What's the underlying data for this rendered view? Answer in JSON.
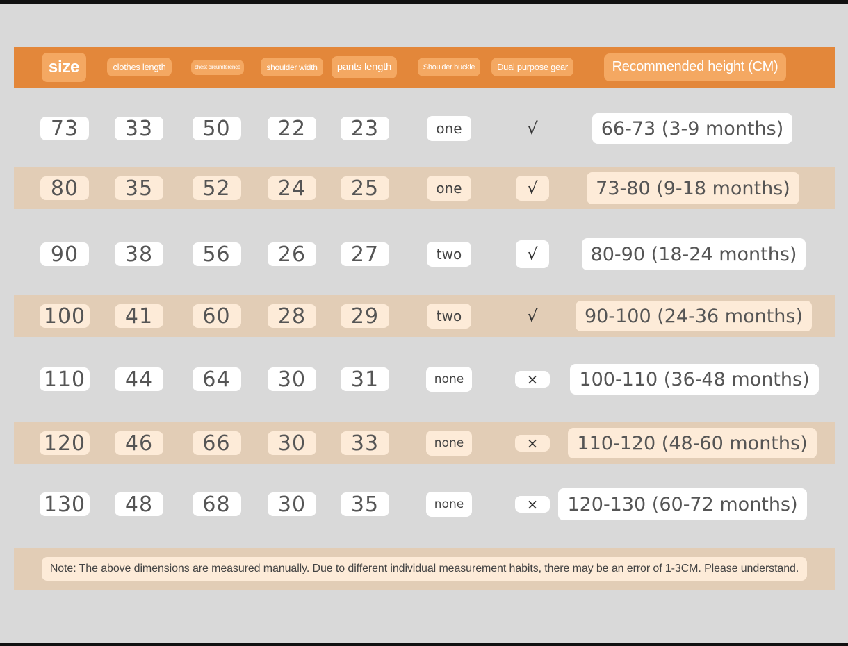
{
  "header": {
    "size": "size",
    "clothes_length": "clothes length",
    "chest_circumference": "chest circumference",
    "shoulder_width": "shoulder width",
    "pants_length": "pants length",
    "shoulder_buckle": "Shoulder buckle",
    "dual_purpose_gear": "Dual purpose gear",
    "recommended_height": "Recommended height (CM)"
  },
  "rows": [
    {
      "size": "73",
      "clothes_length": "33",
      "chest": "50",
      "shoulder": "22",
      "pants": "23",
      "buckle": "one",
      "dual": "√",
      "height": "66-73 (3-9 months)"
    },
    {
      "size": "80",
      "clothes_length": "35",
      "chest": "52",
      "shoulder": "24",
      "pants": "25",
      "buckle": "one",
      "dual": "√",
      "height": "73-80 (9-18 months)"
    },
    {
      "size": "90",
      "clothes_length": "38",
      "chest": "56",
      "shoulder": "26",
      "pants": "27",
      "buckle": "two",
      "dual": "√",
      "height": "80-90 (18-24 months)"
    },
    {
      "size": "100",
      "clothes_length": "41",
      "chest": "60",
      "shoulder": "28",
      "pants": "29",
      "buckle": "two",
      "dual": "√",
      "height": "90-100 (24-36 months)"
    },
    {
      "size": "110",
      "clothes_length": "44",
      "chest": "64",
      "shoulder": "30",
      "pants": "31",
      "buckle": "none",
      "dual": "×",
      "height": "100-110 (36-48 months)"
    },
    {
      "size": "120",
      "clothes_length": "46",
      "chest": "66",
      "shoulder": "30",
      "pants": "33",
      "buckle": "none",
      "dual": "×",
      "height": "110-120 (48-60 months)"
    },
    {
      "size": "130",
      "clothes_length": "48",
      "chest": "68",
      "shoulder": "30",
      "pants": "35",
      "buckle": "none",
      "dual": "×",
      "height": "120-130 (60-72 months)"
    }
  ],
  "note": "Note: The above dimensions are measured manually. Due to different individual measurement habits, there may be an error of 1-3CM. Please understand.",
  "colors": {
    "header_bg": "#e3873a",
    "header_pill": "#f4a862",
    "band": "#e2cdb6",
    "band_pill": "#fdebd8",
    "page_bg": "#d9d9d9"
  }
}
